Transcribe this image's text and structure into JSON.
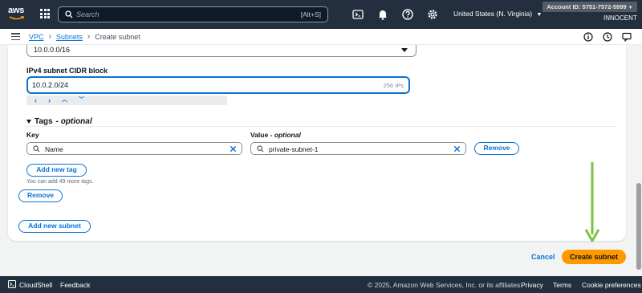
{
  "topnav": {
    "logo_text": "aws",
    "search_placeholder": "Search",
    "search_shortcut": "[Alt+S]",
    "region": "United States (N. Virginia)",
    "account": "Account ID: 5751-7572-5999",
    "user": "INNOCENT"
  },
  "breadcrumb": {
    "items": [
      "VPC",
      "Subnets",
      "Create subnet"
    ]
  },
  "form": {
    "vpc_cidr_value": "10.0.0.0/16",
    "ipv4_label": "IPv4 subnet CIDR block",
    "ipv4_value": "10.0.2.0/24",
    "ipv4_hint": "256 IPs",
    "tags_title": "Tags",
    "tags_optional": "- optional",
    "key_label": "Key",
    "value_label": "Value",
    "value_optional": "- optional",
    "tag_key": "Name",
    "tag_value": "private-subnet-1",
    "remove_tag_label": "Remove",
    "add_tag_label": "Add new tag",
    "tags_note": "You can add 49 more tags.",
    "remove_subnet_label": "Remove",
    "add_subnet_label": "Add new subnet"
  },
  "actions": {
    "cancel": "Cancel",
    "create": "Create subnet"
  },
  "footer": {
    "cloudshell": "CloudShell",
    "feedback": "Feedback",
    "copyright": "© 2025, Amazon Web Services, Inc. or its affiliates.",
    "privacy": "Privacy",
    "terms": "Terms",
    "cookies": "Cookie preferences"
  },
  "colors": {
    "nav_bg": "#232f3e",
    "link_blue": "#0972d3",
    "primary_orange": "#ff9900",
    "annotation_green": "#7cc242"
  }
}
